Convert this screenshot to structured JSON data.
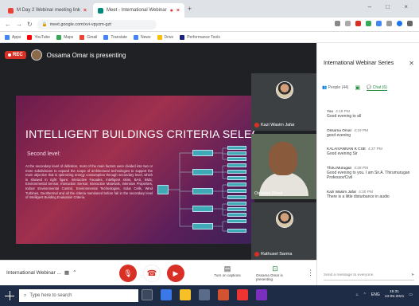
{
  "browser": {
    "tabs": [
      {
        "label": "M Day 2 Webinar meeting link",
        "active": false
      },
      {
        "label": "Meet - International Webinar",
        "active": true
      }
    ],
    "url": "meet.google.com/xvi-vpyzm-gzt",
    "bookmarks": [
      "Apps",
      "YouTube",
      "Maps",
      "Gmail",
      "Translate",
      "News",
      "Drive",
      "Performance Tools"
    ]
  },
  "meet": {
    "rec_label": "REC",
    "presenting_text": "Ossama Omar is presenting",
    "slide": {
      "title": "INTELLIGENT BUILDINGS CRITERIA SELECTION",
      "subtitle": "Second level:",
      "body": "At the secondary level of definition, most of the main factors were divided into two or more subdivisions to expand the scope of architectural technologies to support the main objective that is optimizing energy consumption through secondary level, which is showed in right figure: Interactive Facades, Intelligent skins, BAS, EMS, Environmental Sensor, Interaction Sensor, Interactive Materials, Intensive Properties, Indoor Environmental Control, Environmental Technologies, Solar Cells, Wind Turbines, Geothermal and all the criteria mentioned before fall in the secondary level of Intelligent Building Evaluation Criteria."
    },
    "participants": [
      {
        "name": "Kazi Wasim Jafar",
        "type": "avatar"
      },
      {
        "name": "Ossama Omar",
        "type": "video"
      },
      {
        "name": "Rathusel Sarma",
        "type": "avatar"
      }
    ],
    "meeting_name": "International Webinar ...",
    "controls": {
      "captions_label": "Turn on captions",
      "present_label": "Ossama Omar is presenting"
    }
  },
  "side_panel": {
    "title": "International Webinar Series",
    "people_label": "People (44)",
    "chat_label": "Chat (6)",
    "messages": [
      {
        "author": "You",
        "time": "4:19 PM",
        "text": "Good evening to all"
      },
      {
        "author": "Ossama Omar",
        "time": "4:19 PM",
        "text": "good evening"
      },
      {
        "author": "KALAIVANNAN K CSE",
        "time": "4:27 PM",
        "text": "Good evening Sir"
      },
      {
        "author": "Thiru Murugan",
        "time": "4:28 PM",
        "text": "Good evening to you. I am Sir.A. Thirumurugan Professor/Civil"
      },
      {
        "author": "Kazi Wasim Jafar",
        "time": "4:30 PM",
        "text": "There is a little disturbance in audio"
      }
    ],
    "send_placeholder": "Send a message to everyone"
  },
  "taskbar": {
    "search_placeholder": "Type here to search",
    "time": "16:31",
    "date": "13-05-2021",
    "lang": "ENG"
  },
  "colors": {
    "meet_bg": "#202124",
    "rec_red": "#d93025",
    "accent_green": "#1e8e3e",
    "taskbar_bg": "#1f2c45"
  }
}
